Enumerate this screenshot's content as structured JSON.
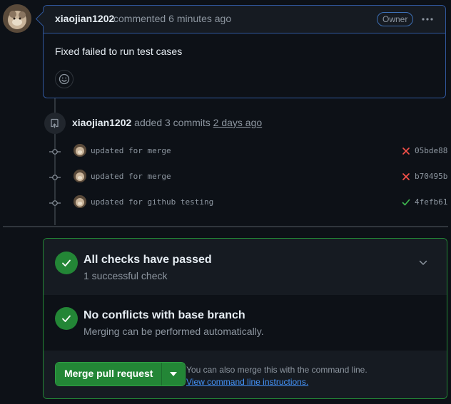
{
  "comment": {
    "author": "xiaojian1202",
    "action": "commented",
    "time": "6 minutes ago",
    "badge": "Owner",
    "body": "Fixed failed to run test cases"
  },
  "push_event": {
    "author": "xiaojian1202",
    "action": "added 3 commits",
    "time": "2 days ago"
  },
  "commits": [
    {
      "message": "updated for merge",
      "status": "failure",
      "sha": "05bde88"
    },
    {
      "message": "updated for merge",
      "status": "failure",
      "sha": "b70495b"
    },
    {
      "message": "updated for github testing",
      "status": "success",
      "sha": "4fefb61"
    }
  ],
  "merge_box": {
    "checks": {
      "title": "All checks have passed",
      "subtitle": "1 successful check"
    },
    "conflicts": {
      "title": "No conflicts with base branch",
      "subtitle": "Merging can be performed automatically."
    },
    "merge_button_label": "Merge pull request",
    "hint_text": "You can also merge this with the command line.",
    "hint_link": "View command line instructions."
  },
  "colors": {
    "accent_blue": "#4493f8",
    "success_green": "#238636",
    "danger_red": "#f85149",
    "background": "#0d1117"
  }
}
